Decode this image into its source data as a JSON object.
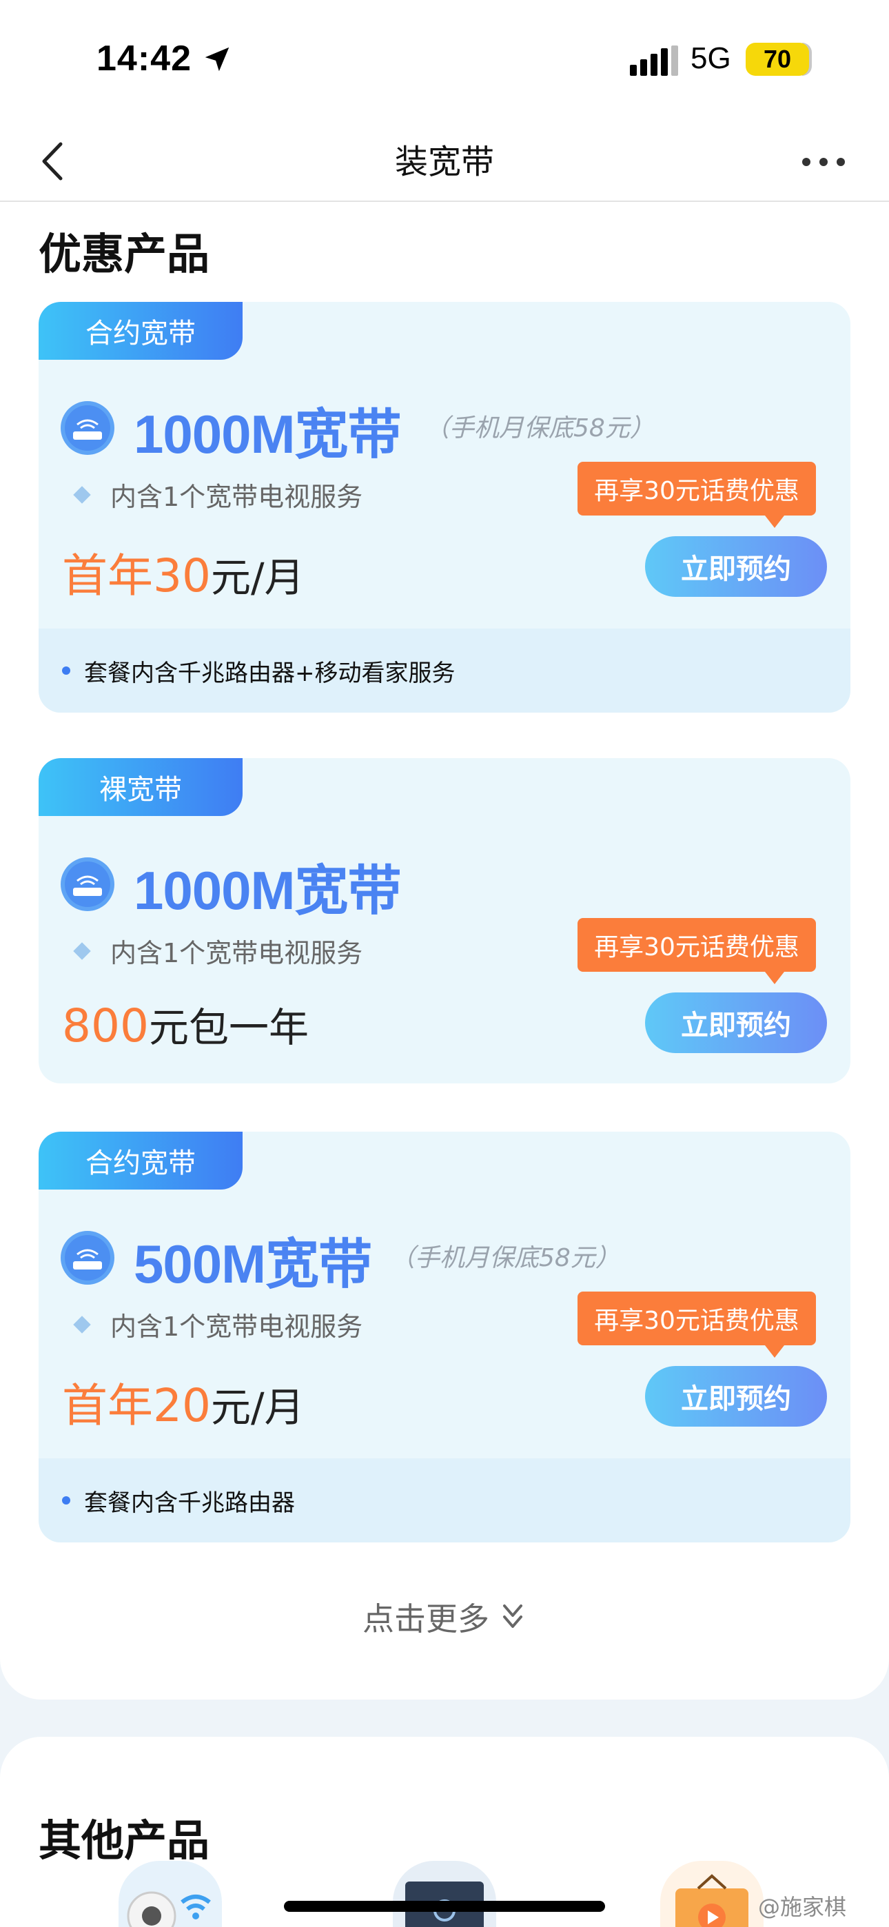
{
  "status_bar": {
    "time": "14:42",
    "network": "5G",
    "battery": "70"
  },
  "nav": {
    "title": "装宽带"
  },
  "section_title": "优惠产品",
  "cards": [
    {
      "tag": "合约宽带",
      "name": "1000M宽带",
      "note": "（手机月保底58元）",
      "feature": "内含1个宽带电视服务",
      "promo": "再享30元话费优惠",
      "price_highlight": "首年30",
      "price_unit": "元/月",
      "button": "立即预约",
      "footer": "套餐内含千兆路由器+移动看家服务"
    },
    {
      "tag": "裸宽带",
      "name": "1000M宽带",
      "note": "",
      "feature": "内含1个宽带电视服务",
      "promo": "再享30元话费优惠",
      "price_highlight": "800",
      "price_unit": "元包一年",
      "button": "立即预约",
      "footer": ""
    },
    {
      "tag": "合约宽带",
      "name": "500M宽带",
      "note": "（手机月保底58元）",
      "feature": "内含1个宽带电视服务",
      "promo": "再享30元话费优惠",
      "price_highlight": "首年20",
      "price_unit": "元/月",
      "button": "立即预约",
      "footer": "套餐内含千兆路由器"
    }
  ],
  "more_label": "点击更多",
  "other_title": "其他产品",
  "watermark": "@施家棋",
  "colors": {
    "accent_blue": "#4a83f2",
    "orange": "#fb7d3b",
    "card_bg": "#eaf7fc"
  }
}
